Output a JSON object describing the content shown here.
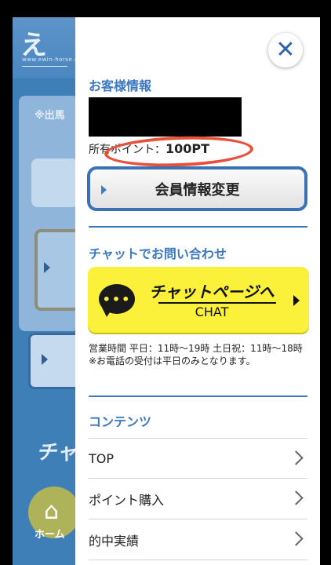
{
  "background": {
    "logo_text": "え",
    "logo_sub": "www.ewin-horse.com",
    "notice": "※出馬",
    "chat_label": "チャ",
    "home_label": "ホーム"
  },
  "drawer": {
    "close_icon": "close-icon",
    "customer_info_title": "お客様情報",
    "points_label": "所有ポイント：",
    "points_value": "100PT",
    "member_button_label": "会員情報変更",
    "chat_section_title": "チャットでお問い合わせ",
    "chat_button_main": "チャットページへ",
    "chat_button_sub": "CHAT",
    "chat_icon_glyph": "•••",
    "hours_line1": "営業時間 平日：11時〜19時 土日祝：11時〜18時",
    "hours_line2": "※お電話の受付は平日のみとなります。",
    "contents_title": "コンテンツ",
    "menu_items": [
      {
        "label": "TOP"
      },
      {
        "label": "ポイント購入"
      },
      {
        "label": "的中実績"
      }
    ]
  },
  "colors": {
    "accent": "#3a78c0",
    "chat_yellow": "#fbf03a",
    "highlight_circle": "#e8503a"
  }
}
